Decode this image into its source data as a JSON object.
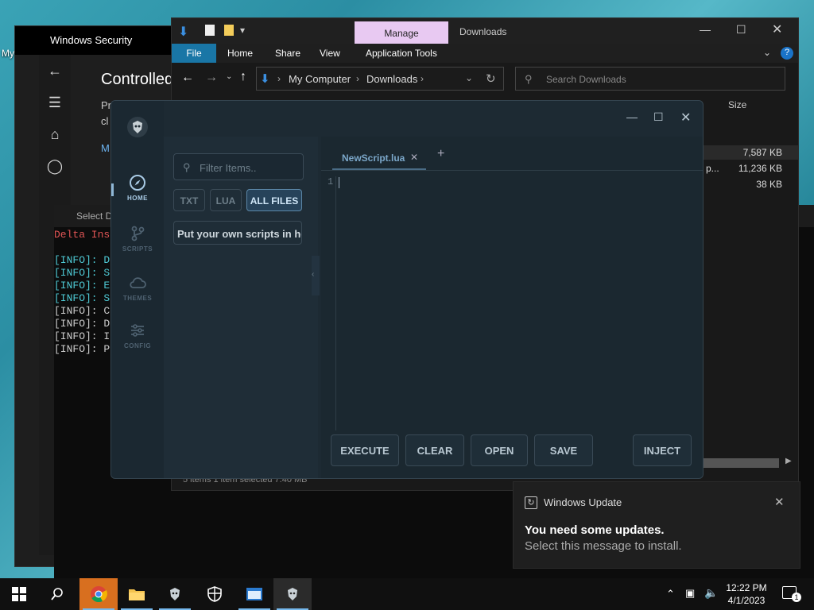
{
  "desktop": {
    "label": "My"
  },
  "windows_security": {
    "title": "Windows Security",
    "heading": "Controlled",
    "text_line1": "Pr",
    "text_line2": "cl",
    "link": "M"
  },
  "console": {
    "title": "Select D",
    "header": "Delta Ins",
    "lines": [
      "[INFO]: D",
      "[INFO]: S",
      "[INFO]: E",
      "[INFO]: S",
      "[INFO]: C",
      "[INFO]: D",
      "[INFO]: I",
      "[INFO]: P"
    ]
  },
  "explorer": {
    "context_tab": "Manage",
    "title": "Downloads",
    "ribbon_tabs": [
      "File",
      "Home",
      "Share",
      "View",
      "Application Tools"
    ],
    "breadcrumb": [
      "My Computer",
      "Downloads"
    ],
    "search_placeholder": "Search Downloads",
    "size_header": "Size",
    "file_sizes": [
      "7,587 KB",
      "11,236 KB",
      "38 KB"
    ],
    "row2_partial": "p...",
    "status": "5 items   1 item selected  7.40 MB"
  },
  "executor": {
    "nav": [
      {
        "label": "HOME",
        "icon": "compass-icon",
        "active": true
      },
      {
        "label": "SCRIPTS",
        "icon": "git-branch-icon",
        "active": false
      },
      {
        "label": "THEMES",
        "icon": "cloud-icon",
        "active": false
      },
      {
        "label": "CONFIG",
        "icon": "sliders-icon",
        "active": false
      }
    ],
    "filter_placeholder": "Filter Items..",
    "file_types": [
      "TXT",
      "LUA",
      "ALL FILES"
    ],
    "active_file_type": "ALL FILES",
    "script_items": [
      "Put your own scripts in he"
    ],
    "tab_name": "NewScript.lua",
    "line_number": "1",
    "buttons": {
      "execute": "EXECUTE",
      "clear": "CLEAR",
      "open": "OPEN",
      "save": "SAVE",
      "inject": "INJECT"
    }
  },
  "notification": {
    "app": "Windows Update",
    "title": "You need some updates.",
    "body": "Select this message to install."
  },
  "taskbar": {
    "time": "12:22 PM",
    "date": "4/1/2023",
    "notification_count": "1"
  }
}
